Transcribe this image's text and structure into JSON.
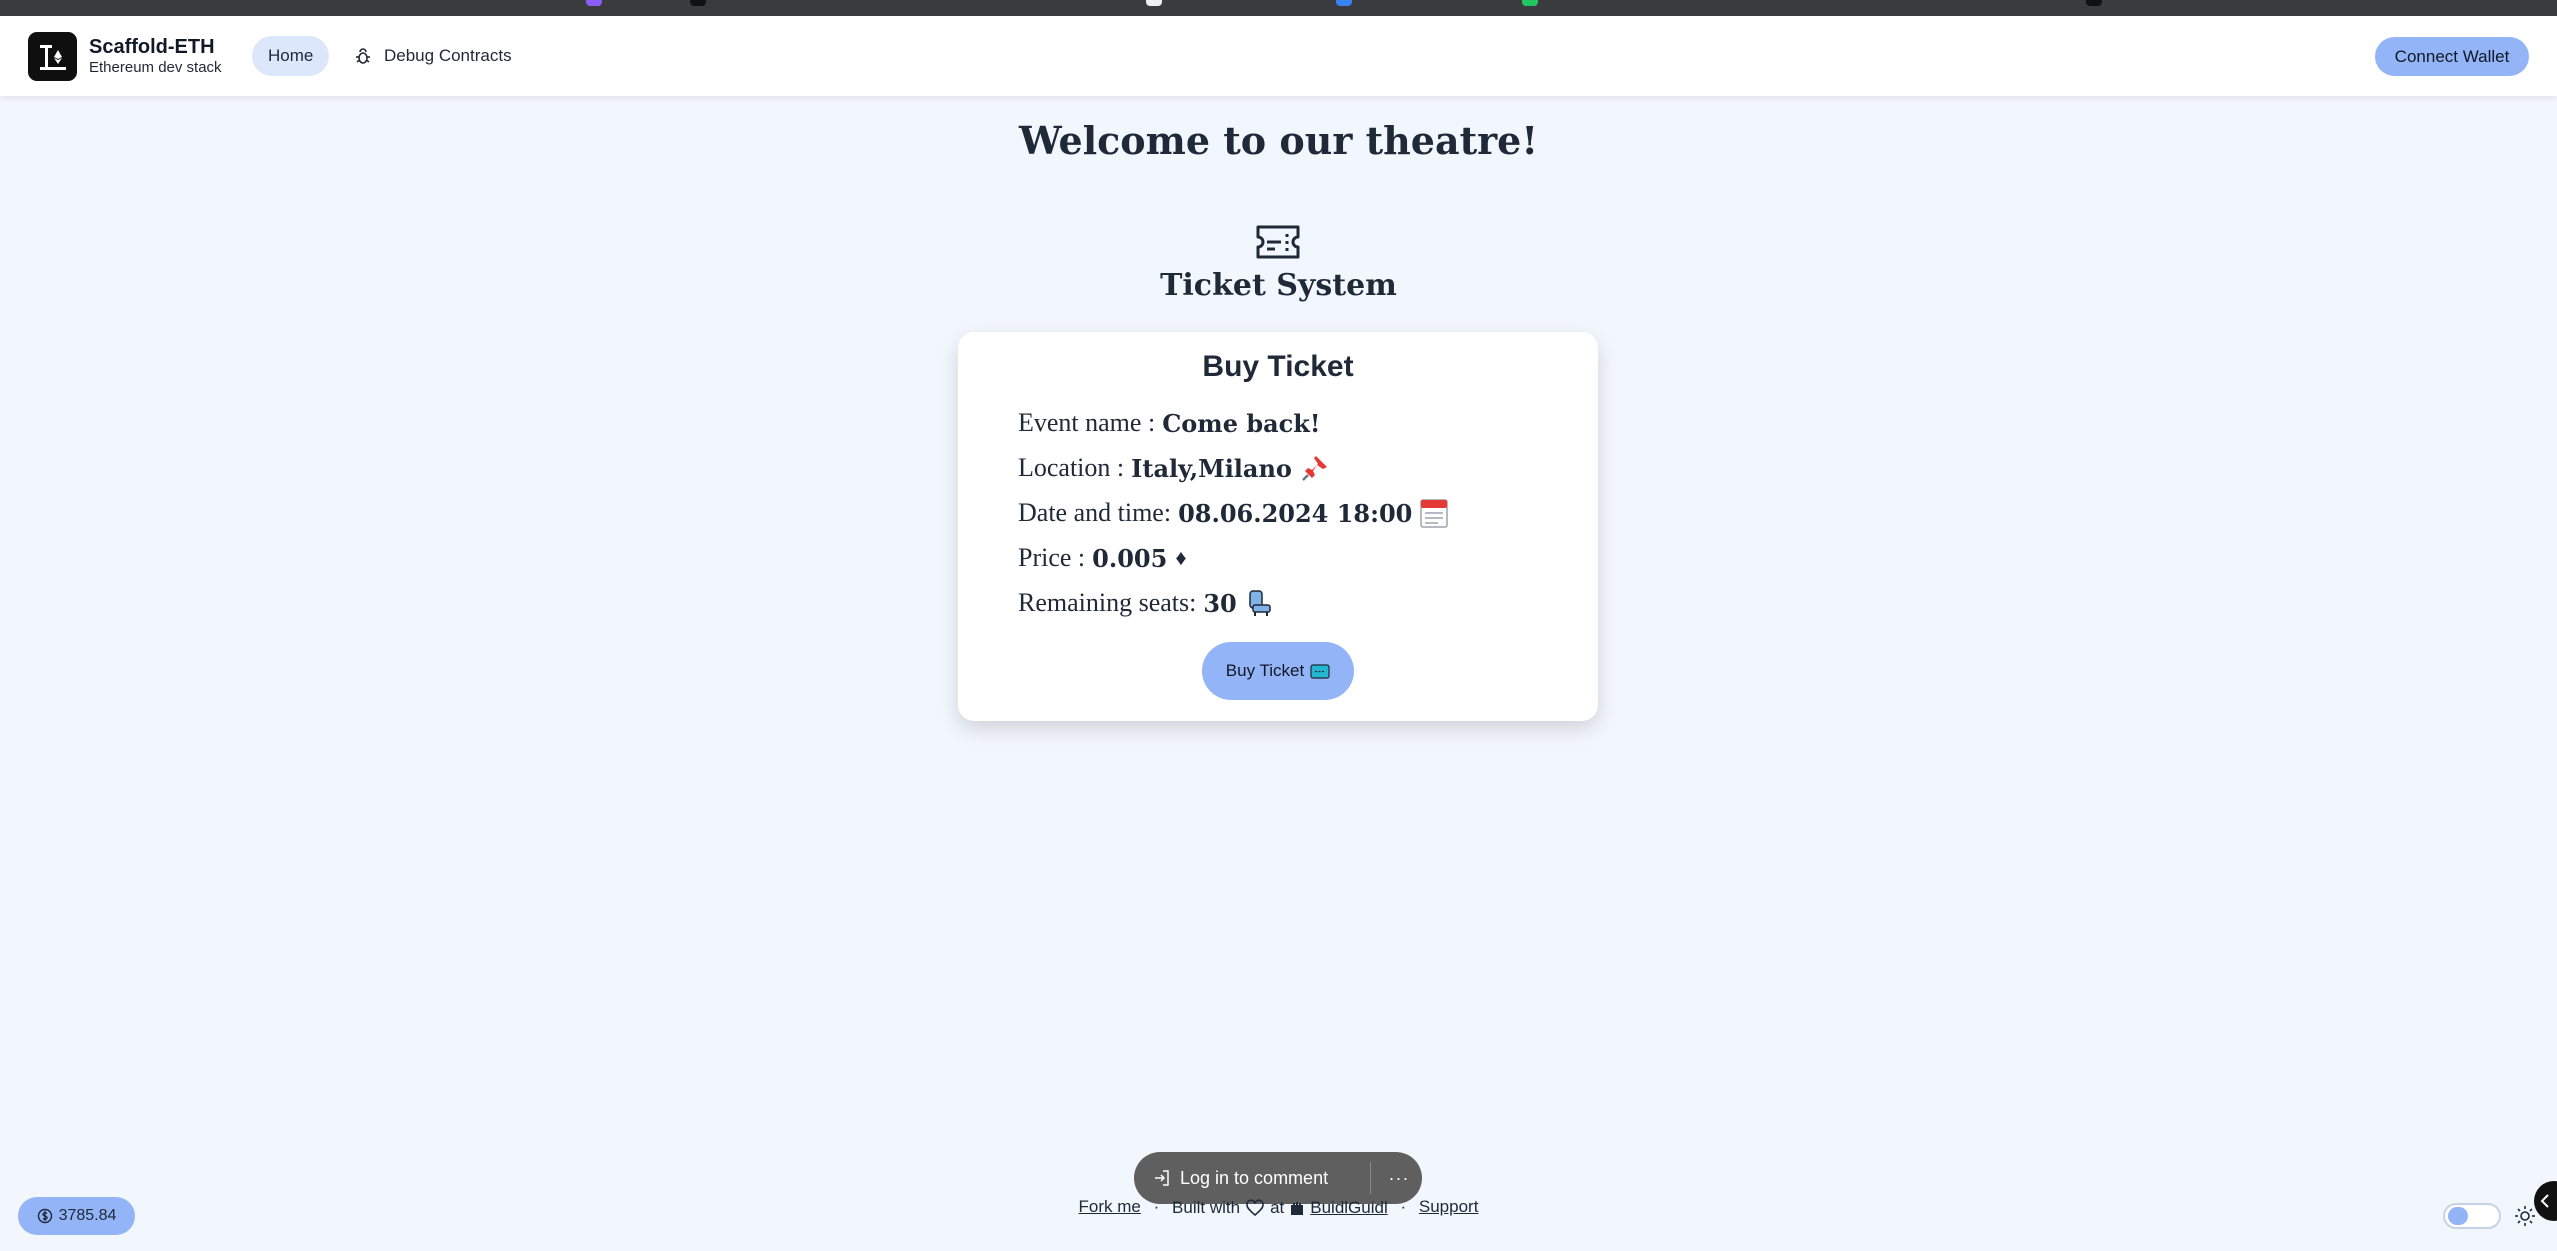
{
  "navbar": {
    "brand_title": "Scaffold-ETH",
    "brand_subtitle": "Ethereum dev stack",
    "home_label": "Home",
    "debug_label": "Debug Contracts",
    "connect_label": "Connect Wallet"
  },
  "main": {
    "welcome": "Welcome to our theatre!",
    "system_title": "Ticket System"
  },
  "card": {
    "title": "Buy Ticket",
    "event_label": "Event name :",
    "event_value": "Come back!",
    "location_label": "Location :",
    "location_value": "Italy,Milano",
    "datetime_label": "Date and time:",
    "datetime_value": "08.06.2024 18:00",
    "price_label": "Price :",
    "price_value": "0.005",
    "price_symbol": "♦",
    "seats_label": "Remaining seats:",
    "seats_value": "30",
    "buy_button_label": "Buy Ticket"
  },
  "footer": {
    "balance": "3785.84",
    "fork_label": "Fork me",
    "built_with": "Built with",
    "at": "at",
    "buidlguidl_label": "BuidlGuidl",
    "support_label": "Support"
  },
  "comment": {
    "login_label": "Log in to comment",
    "more_label": "···"
  },
  "icons": {
    "brand": "scaffold-logo-icon",
    "debug": "bug-icon",
    "ticket": "ticket-icon",
    "location": "pushpin-icon",
    "calendar": "calendar-icon",
    "seat": "seat-icon",
    "heart": "heart-icon",
    "balance": "currency-icon",
    "theme": "sun-icon"
  },
  "colors": {
    "accent": "#93b4f7",
    "background": "#f2f6fd",
    "home_active": "#dde7fb"
  }
}
